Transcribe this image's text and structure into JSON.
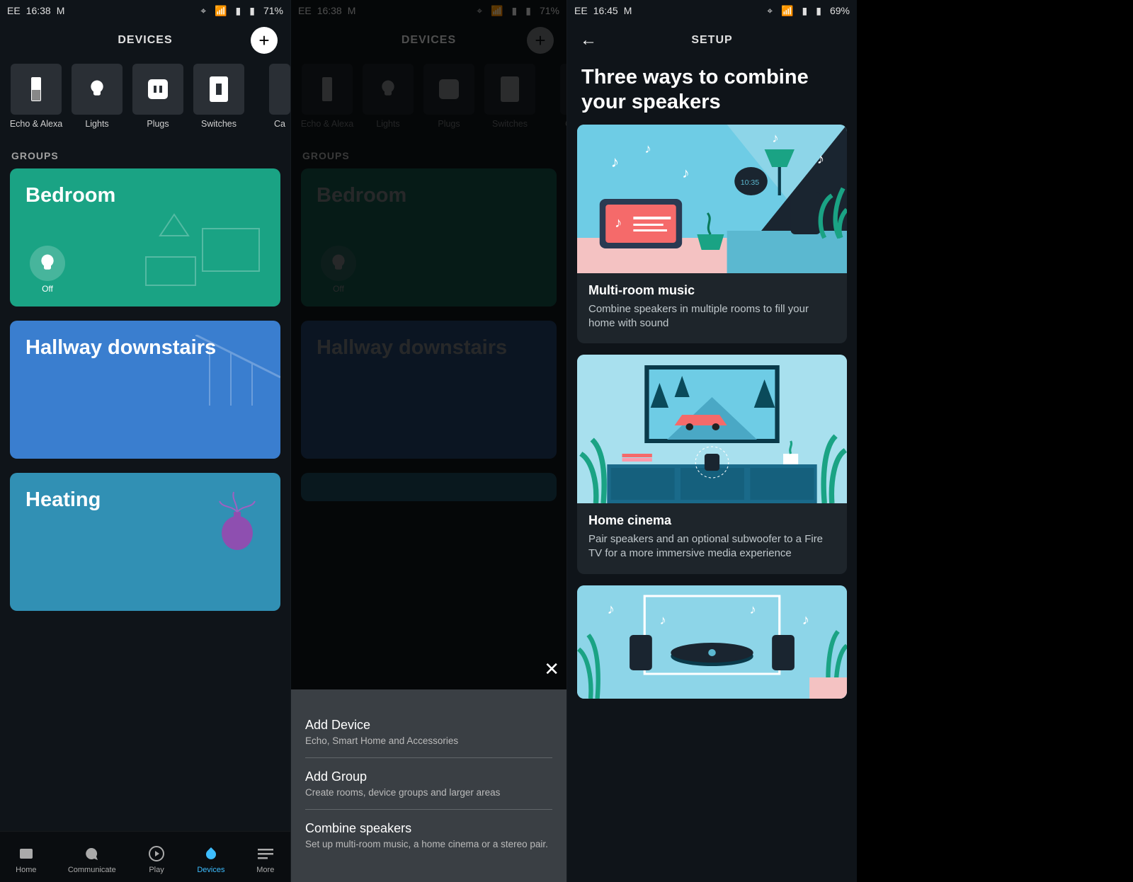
{
  "status": {
    "carrier": "EE",
    "time1": "16:38",
    "time2": "16:45",
    "battery1": "71%",
    "battery2": "69%"
  },
  "screen1": {
    "title": "DEVICES",
    "sectionLabel": "GROUPS",
    "categories": [
      {
        "label": "Echo & Alexa"
      },
      {
        "label": "Lights"
      },
      {
        "label": "Plugs"
      },
      {
        "label": "Switches"
      },
      {
        "label": "Ca"
      }
    ],
    "groups": [
      {
        "name": "Bedroom",
        "widgetLabel": "Off"
      },
      {
        "name": "Hallway downstairs"
      },
      {
        "name": "Heating"
      }
    ],
    "nav": [
      {
        "label": "Home"
      },
      {
        "label": "Communicate"
      },
      {
        "label": "Play"
      },
      {
        "label": "Devices"
      },
      {
        "label": "More"
      }
    ]
  },
  "screen2": {
    "sheet": [
      {
        "title": "Add Device",
        "sub": "Echo, Smart Home and Accessories"
      },
      {
        "title": "Add Group",
        "sub": "Create rooms, device groups and larger areas"
      },
      {
        "title": "Combine speakers",
        "sub": "Set up multi-room music, a home cinema or a stereo pair."
      }
    ]
  },
  "screen3": {
    "title": "SETUP",
    "headline": "Three ways to combine your speakers",
    "cards": [
      {
        "title": "Multi-room music",
        "desc": "Combine speakers in multiple rooms to fill your home with sound"
      },
      {
        "title": "Home cinema",
        "desc": "Pair speakers and an optional subwoofer to a Fire TV for a more immersive media experience"
      }
    ]
  }
}
